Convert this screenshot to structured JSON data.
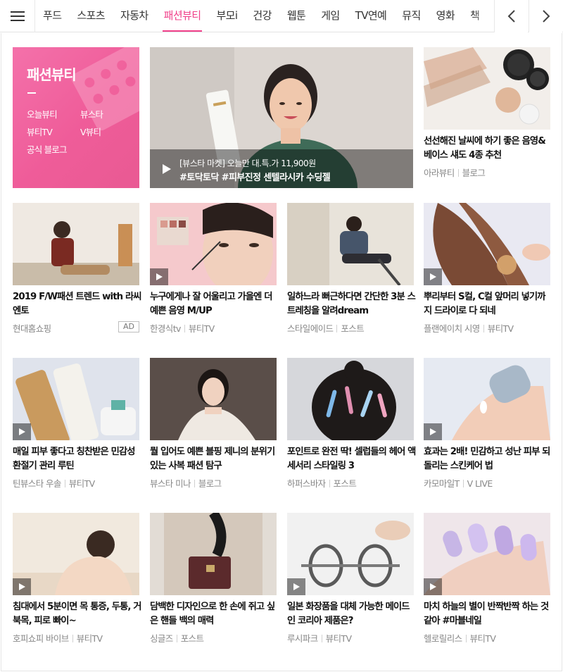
{
  "nav": {
    "menu_icon": "hamburger-icon",
    "tabs": [
      {
        "label": "푸드"
      },
      {
        "label": "스포츠"
      },
      {
        "label": "자동차"
      },
      {
        "label": "패션뷰티"
      },
      {
        "label": "부모i"
      },
      {
        "label": "건강"
      },
      {
        "label": "웹툰"
      },
      {
        "label": "게임"
      },
      {
        "label": "TV연예"
      },
      {
        "label": "뮤직"
      },
      {
        "label": "영화"
      },
      {
        "label": "책"
      }
    ],
    "active_tab": "패션뷰티",
    "prev_icon": "chevron-left-icon",
    "next_icon": "chevron-right-icon"
  },
  "category": {
    "title": "패션뷰티",
    "links": [
      "오늘뷰티",
      "뷰스타",
      "뷰티TV",
      "V뷰티",
      "공식 블로그"
    ]
  },
  "featured": {
    "line1": "[뷰스타 마켓] 오늘만 대.특.가 11,900원",
    "line2": "#토닥토닥 #피부진정 센텔라시카 수딩젤"
  },
  "side_card": {
    "title": "선선해진 날씨에 하기 좋은 음영&베이스 섀도 4종 추천",
    "source": "아라뷰티",
    "type": "블로그"
  },
  "cards": [
    {
      "title": "2019 F/W패션 트렌드 with 라씨엔토",
      "source": "현대홈쇼핑",
      "type": "",
      "ad": "AD"
    },
    {
      "title": "누구에게나 잘 어울리고 가을엔 더 예쁜 음영 M/UP",
      "source": "한경식tv",
      "type": "뷰티TV"
    },
    {
      "title": "일하느라 뻐근하다면 간단한 3분 스트레칭을 알려dream",
      "source": "스타일에이드",
      "type": "포스트"
    },
    {
      "title": "뿌리부터 S컬, C컬 앞머리 넣기까지 드라이로 다 되네",
      "source": "플랜에이치 시영",
      "type": "뷰티TV"
    },
    {
      "title": "매일 피부 좋다고 칭찬받은 민감성 환절기 관리 루틴",
      "source": "틴뷰스타 우솔",
      "type": "뷰티TV"
    },
    {
      "title": "뭘 입어도 예쁜 블핑 제니의 분위기 있는 사복 패션 탐구",
      "source": "뷰스타 미나",
      "type": "블로그"
    },
    {
      "title": "포인트로 완전 딱! 셀럽들의 헤어 액세서리 스타일링 3",
      "source": "하퍼스바자",
      "type": "포스트"
    },
    {
      "title": "효과는 2배! 민감하고 성난 피부 되돌리는 스킨케어 법",
      "source": "카모마일T",
      "type": "V LIVE"
    },
    {
      "title": "침대에서 5분이면 목 통증, 두통, 거북목, 피로 빠이~",
      "source": "호피쇼피 바이브",
      "type": "뷰티TV"
    },
    {
      "title": "담백한 디자인으로 한 손에 쥐고 싶은 핸들 백의 매력",
      "source": "싱글즈",
      "type": "포스트"
    },
    {
      "title": "일본 화장품을 대체 가능한 메이드 인 코리아 제품은?",
      "source": "루시파크",
      "type": "뷰티TV"
    },
    {
      "title": "마치 하늘의 별이 반짝반짝 하는 것 같아 #마블네일",
      "source": "헬로릴리스",
      "type": "뷰티TV"
    }
  ],
  "colors": {
    "accent": "#f0408a",
    "category_bg": "#f06aa4",
    "meta_text": "#888888"
  }
}
